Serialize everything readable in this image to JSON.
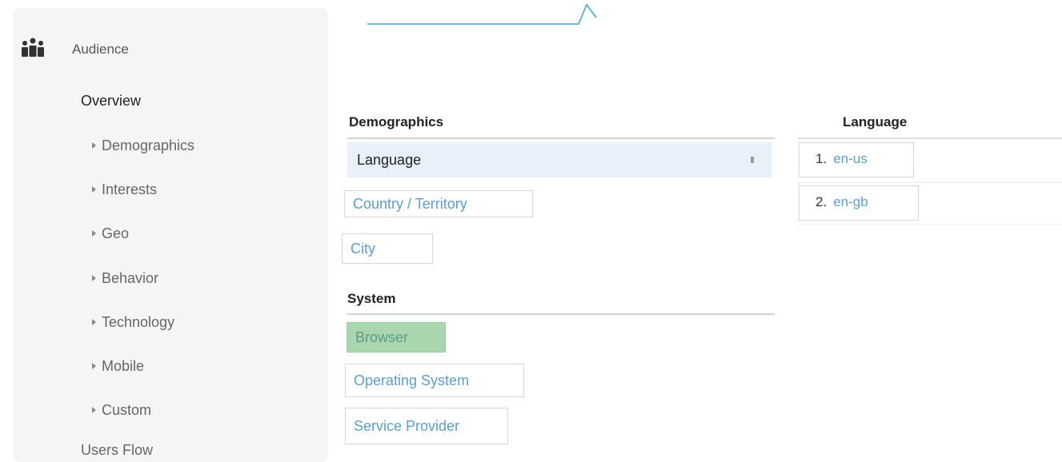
{
  "sidebar": {
    "section_label": "Audience",
    "icon": "audience-icon",
    "items": [
      {
        "label": "Overview",
        "expandable": false
      },
      {
        "label": "Demographics",
        "expandable": true
      },
      {
        "label": "Interests",
        "expandable": true
      },
      {
        "label": "Geo",
        "expandable": true
      },
      {
        "label": "Behavior",
        "expandable": true
      },
      {
        "label": "Technology",
        "expandable": true
      },
      {
        "label": "Mobile",
        "expandable": true
      },
      {
        "label": "Custom",
        "expandable": true
      },
      {
        "label": "Users Flow",
        "expandable": false
      }
    ]
  },
  "demographics": {
    "heading": "Demographics",
    "selected": "Language",
    "items": [
      "Country / Territory",
      "City"
    ]
  },
  "system": {
    "heading": "System",
    "active": "Browser",
    "items": [
      "Operating System",
      "Service Provider"
    ]
  },
  "language_table": {
    "heading": "Language",
    "rows": [
      {
        "num": "1.",
        "value": "en-us"
      },
      {
        "num": "2.",
        "value": "en-gb"
      }
    ]
  },
  "colors": {
    "link": "#5d9ecb",
    "selected_row": "#e8f1fa",
    "active_green": "#a9d6ae",
    "chart_line": "#4ba3c7"
  }
}
